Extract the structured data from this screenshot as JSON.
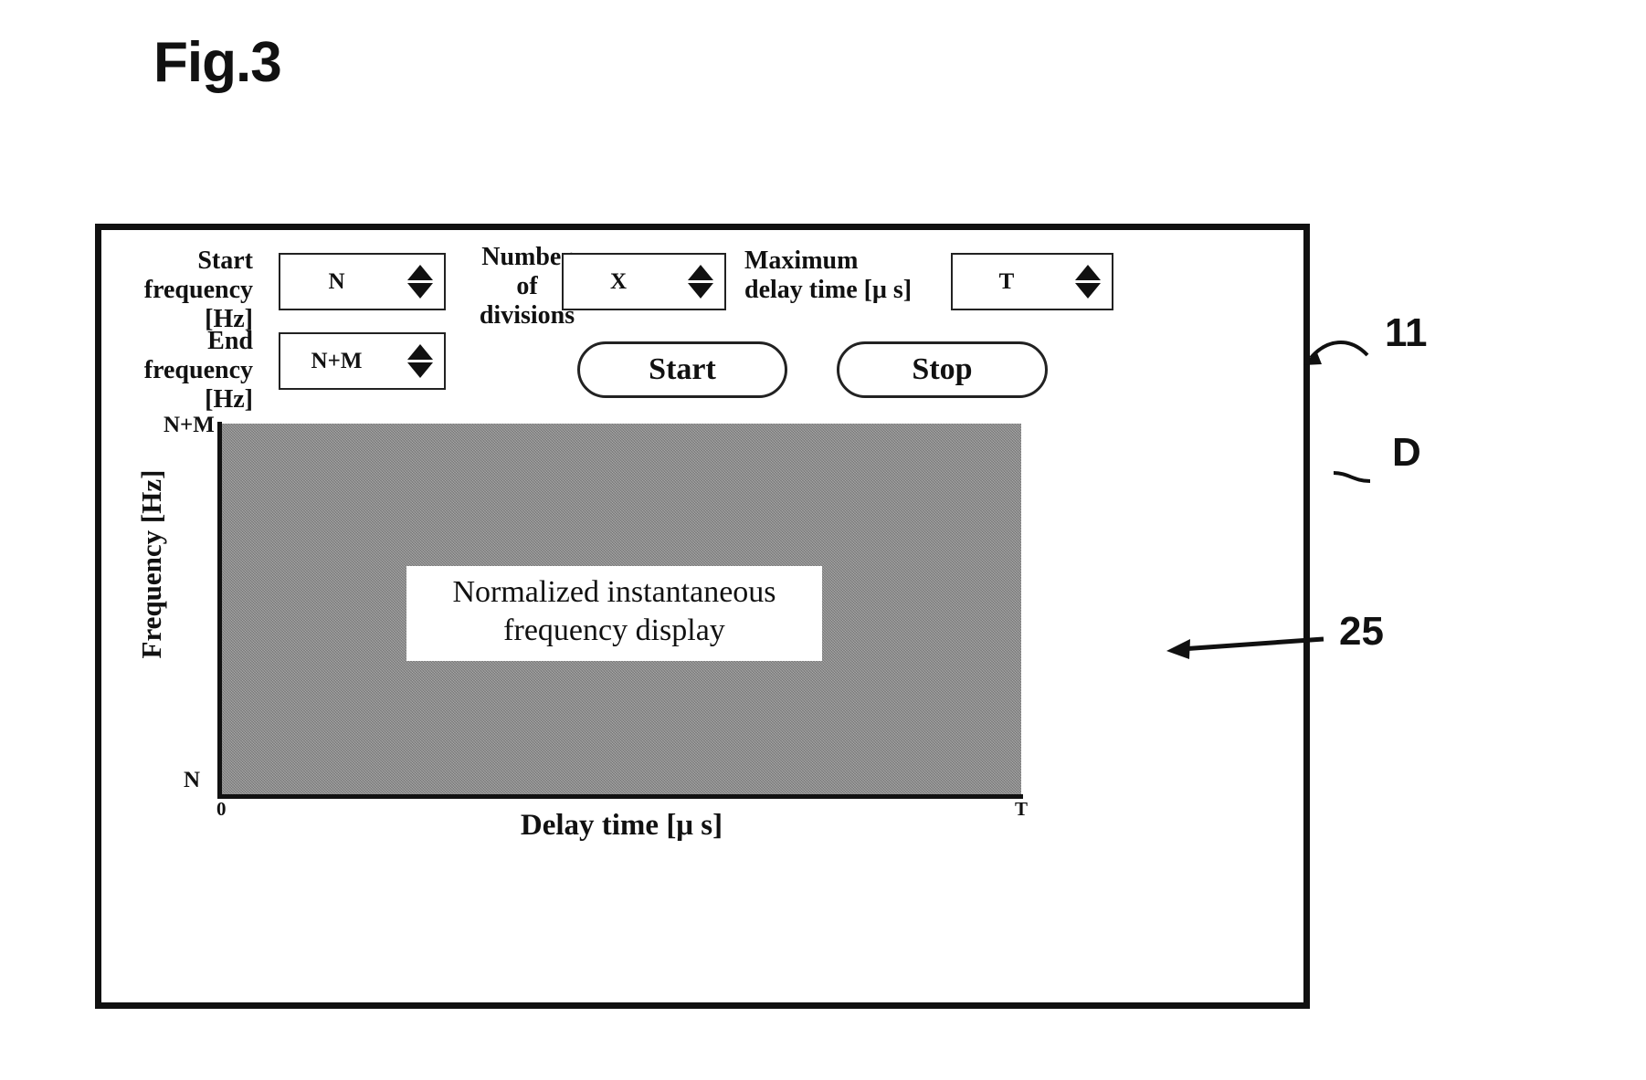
{
  "figure": {
    "title": "Fig.3"
  },
  "panel": {
    "controls": {
      "start_frequency_label": "Start\nfrequency\n[Hz]",
      "start_frequency_value": "N",
      "end_frequency_label": "End\nfrequency\n[Hz]",
      "end_frequency_value": "N+M",
      "number_of_divisions_label": "Number\nof\ndivisions",
      "number_of_divisions_value": "X",
      "maximum_delay_time_label": "Maximum\ndelay time [μ s]",
      "maximum_delay_time_value": "T"
    },
    "buttons": {
      "start_label": "Start",
      "stop_label": "Stop"
    }
  },
  "chart_data": {
    "type": "area",
    "title": "",
    "caption": "Normalized instantaneous\nfrequency display",
    "xlabel": "Delay time [μ s]",
    "ylabel": "Frequency [Hz]",
    "x_ticks": [
      "0",
      "T"
    ],
    "y_ticks": [
      "N",
      "N+M"
    ],
    "ylim": [
      "N",
      "N+M"
    ],
    "xlim": [
      "0",
      "T"
    ],
    "grid": false,
    "legend": "none",
    "fill_color": "#9b9b9b"
  },
  "annotations": {
    "ref_11": "11",
    "ref_D": "D",
    "ref_25": "25"
  }
}
